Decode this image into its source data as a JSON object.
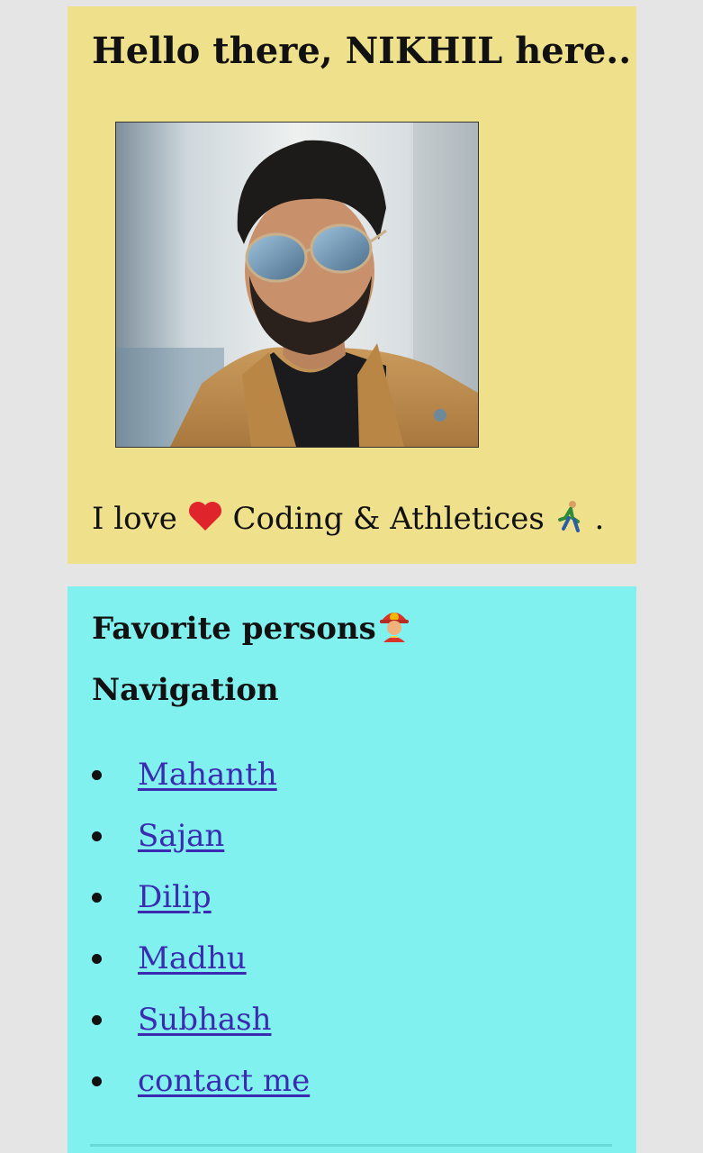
{
  "intro": {
    "title": "Hello there, NIKHIL here..",
    "photo_alt": "Profile photo",
    "text_before": "I love",
    "heart_icon": "red-heart-emoji",
    "text_middle": "Coding & Athletices",
    "runner_icon": "runner-emoji",
    "text_after": "."
  },
  "favorites": {
    "title": "Favorite persons",
    "title_icon": "firefighter-emoji",
    "nav_heading": "Navigation",
    "links": [
      {
        "label": "Mahanth"
      },
      {
        "label": "Sajan"
      },
      {
        "label": "Dilip"
      },
      {
        "label": "Madhu"
      },
      {
        "label": "Subhash"
      },
      {
        "label": "contact me"
      }
    ]
  },
  "colors": {
    "intro_bg": "#efe08b",
    "favorites_bg": "#80f1ef",
    "link": "#3a2bb0",
    "page_bg": "#e5e5e5"
  }
}
